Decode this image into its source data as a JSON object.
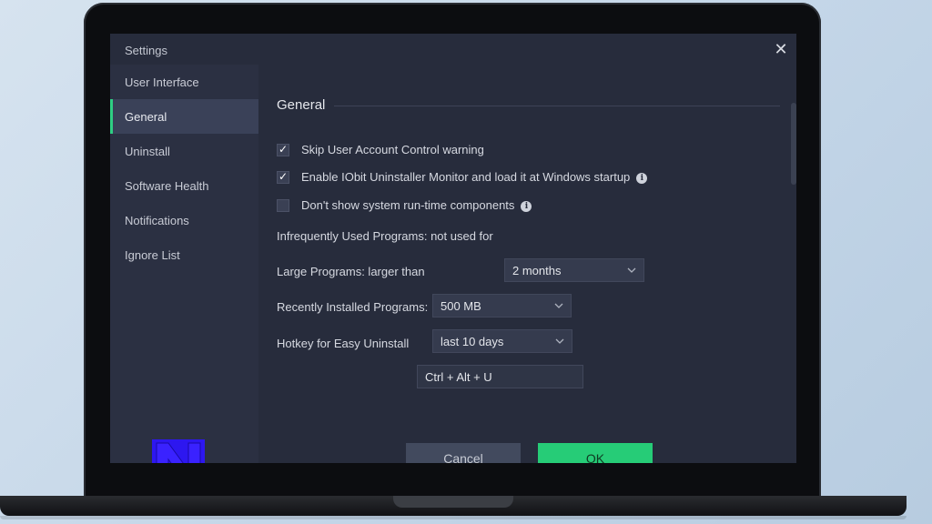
{
  "window": {
    "title": "Settings"
  },
  "sidebar": {
    "items": [
      {
        "label": "User Interface",
        "active": false
      },
      {
        "label": "General",
        "active": true
      },
      {
        "label": "Uninstall",
        "active": false
      },
      {
        "label": "Software Health",
        "active": false
      },
      {
        "label": "Notifications",
        "active": false
      },
      {
        "label": "Ignore List",
        "active": false
      }
    ],
    "logo_text": "N"
  },
  "general": {
    "section_title": "General",
    "options": [
      {
        "label": "Skip User Account Control warning",
        "checked": true,
        "info": false
      },
      {
        "label": "Enable IObit Uninstaller Monitor and load it at Windows startup",
        "checked": true,
        "info": true
      },
      {
        "label": "Don't show system run-time components",
        "checked": false,
        "info": true
      }
    ],
    "infrequent": {
      "label": "Infrequently Used Programs: not used for",
      "value": "2 months"
    },
    "large": {
      "label": "Large Programs: larger than",
      "value": "500 MB"
    },
    "recent": {
      "label": "Recently Installed Programs:",
      "value": "last 10 days"
    },
    "hotkey": {
      "label": "Hotkey for Easy Uninstall",
      "value": "Ctrl + Alt + U"
    }
  },
  "buttons": {
    "cancel": "Cancel",
    "ok": "OK"
  },
  "colors": {
    "accent": "#2fce83",
    "ok_button": "#26cc77",
    "logo": "#2d17f0",
    "window_bg": "#272c3c"
  },
  "icons": {
    "close": "close-icon",
    "info": "info-icon",
    "dropdown": "chevron-down-icon",
    "check": "checkmark-icon"
  }
}
